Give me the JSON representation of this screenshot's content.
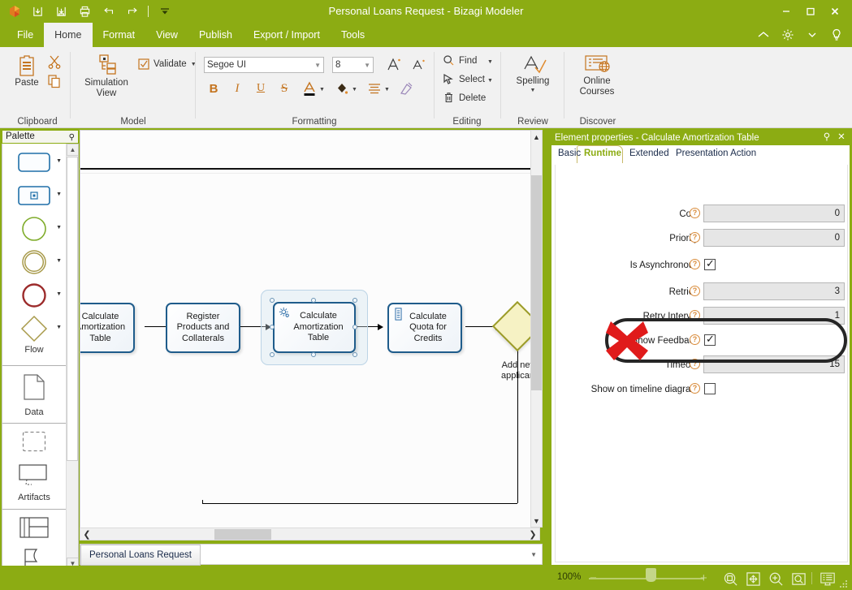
{
  "window": {
    "title": "Personal Loans Request - Bizagi Modeler",
    "quick_access": [
      "bizagi-logo-icon",
      "save-icon",
      "save-as-icon",
      "print-icon",
      "undo-icon",
      "redo-icon",
      "customize-qat-icon"
    ],
    "controls": [
      "minimize-icon",
      "maximize-icon",
      "close-icon"
    ]
  },
  "menu": {
    "tabs": [
      {
        "label": "File",
        "active": false
      },
      {
        "label": "Home",
        "active": true
      },
      {
        "label": "Format",
        "active": false
      },
      {
        "label": "View",
        "active": false
      },
      {
        "label": "Publish",
        "active": false
      },
      {
        "label": "Export / Import",
        "active": false
      },
      {
        "label": "Tools",
        "active": false
      }
    ],
    "right_icons": [
      "collapse-ribbon-icon",
      "settings-gear-icon",
      "chevron-down-icon",
      "help-bulb-icon"
    ]
  },
  "ribbon": {
    "groups": [
      {
        "name": "Clipboard",
        "label": "Clipboard",
        "items": [
          "Paste",
          "Cut",
          "Copy"
        ]
      },
      {
        "name": "Model",
        "label": "Model",
        "items": [
          "Simulation View",
          "Validate"
        ]
      },
      {
        "name": "Formatting",
        "label": "Formatting",
        "items": [
          "Bold",
          "Italic",
          "Underline",
          "Strikethrough",
          "Font Color",
          "Fill Color",
          "Align",
          "Format Painter"
        ]
      },
      {
        "name": "Editing",
        "label": "Editing",
        "items": [
          "Find",
          "Select",
          "Delete"
        ]
      },
      {
        "name": "Review",
        "label": "Review",
        "items": [
          "Spelling"
        ]
      },
      {
        "name": "Discover",
        "label": "Discover",
        "items": [
          "Online Courses"
        ]
      }
    ],
    "paste_label": "Paste",
    "simulation_label_line1": "Simulation",
    "simulation_label_line2": "View",
    "validate_label": "Validate",
    "font_name": "Segoe UI",
    "font_size": "8",
    "find_label": "Find",
    "select_label": "Select",
    "delete_label": "Delete",
    "spelling_label": "Spelling",
    "online_courses_line1": "Online",
    "online_courses_line2": "Courses"
  },
  "palette": {
    "title": "Palette",
    "pin_icon": "pin-icon",
    "sections": [
      {
        "name": "Flow",
        "label": "Flow",
        "shapes": [
          "task-rounded-rect",
          "subprocess-rounded-rect",
          "start-event-circle",
          "intermediate-event-circle",
          "end-event-circle",
          "gateway-diamond"
        ]
      },
      {
        "name": "Data",
        "label": "Data",
        "shapes": [
          "data-object-page"
        ]
      },
      {
        "name": "Artifacts",
        "label": "Artifacts",
        "shapes": [
          "group-dashed-rect",
          "annotation-rect"
        ]
      },
      {
        "name": "More",
        "label": "",
        "shapes": [
          "table-icon",
          "ribbon-shape-icon"
        ]
      }
    ]
  },
  "canvas": {
    "tasks": [
      {
        "name": "task-calculate-amortization-table-left",
        "lines": [
          "Calculate",
          "Amortization",
          "Table"
        ],
        "icon": null,
        "selected": false
      },
      {
        "name": "task-register-products-and-collaterals",
        "lines": [
          "Register",
          "Products and",
          "Collaterals"
        ],
        "icon": null,
        "selected": false
      },
      {
        "name": "task-calculate-amortization-table",
        "lines": [
          "Calculate",
          "Amortization",
          "Table"
        ],
        "icon": "service-task-gear-icon",
        "selected": true
      },
      {
        "name": "task-calculate-quota-for-credits",
        "lines": [
          "Calculate",
          "Quota for",
          "Credits"
        ],
        "icon": "script-task-icon",
        "selected": false
      }
    ],
    "gateway": {
      "name": "gateway-add-new-applicant",
      "label_line1": "Add new",
      "label_line2": "applicant"
    }
  },
  "doc_tabs": {
    "tabs": [
      {
        "label": "Personal Loans Request",
        "active": true
      }
    ],
    "dropdown_icon": "chevron-down-icon"
  },
  "properties": {
    "header": "Element properties - Calculate Amortization Table",
    "header_buttons": [
      "pin-icon",
      "close-icon"
    ],
    "tabs": [
      {
        "label": "Basic",
        "active": false
      },
      {
        "label": "Runtime",
        "active": true
      },
      {
        "label": "Extended",
        "active": false
      },
      {
        "label": "Presentation Action",
        "active": false
      }
    ],
    "fields": [
      {
        "name": "cost",
        "label": "Cost",
        "type": "text",
        "value": "0",
        "help": "?"
      },
      {
        "name": "priority",
        "label": "Priority",
        "type": "text",
        "value": "0",
        "help": "?"
      },
      {
        "name": "is-asynchronous",
        "label": "Is Asynchronous",
        "type": "checkbox",
        "checked": true,
        "help": "?"
      },
      {
        "name": "retries",
        "label": "Retries",
        "type": "text",
        "value": "3",
        "help": "?"
      },
      {
        "name": "retry-interval",
        "label": "Retry Interval",
        "type": "text",
        "value": "1",
        "help": "?"
      },
      {
        "name": "show-feedback",
        "label": "Show Feedback",
        "type": "checkbox",
        "checked": true,
        "help": "?"
      },
      {
        "name": "timeout",
        "label": "Timeout",
        "type": "text",
        "value": "15",
        "help": "?",
        "annotated": true
      },
      {
        "name": "show-on-timeline-diagram",
        "label": "Show on timeline diagram",
        "type": "checkbox",
        "checked": false,
        "help": "?"
      }
    ]
  },
  "annotation": {
    "x_mark_color": "#E01B1B",
    "ellipse_color": "#262626",
    "target_field": "timeout"
  },
  "statusbar": {
    "zoom_label": "100%",
    "zoom_out": "−",
    "zoom_in": "+",
    "icons": [
      "zoom-selection-icon",
      "fit-to-page-icon",
      "zoom-in-icon",
      "zoom-region-icon",
      "presentation-view-icon"
    ]
  },
  "colors": {
    "brand_green": "#8CAC13",
    "ribbon_bg": "#f1f1f1",
    "task_border": "#1F5C8B",
    "gateway_fill": "#f6f2c4",
    "gateway_border": "#9B9B28",
    "accent_orange": "#D98B3A"
  }
}
